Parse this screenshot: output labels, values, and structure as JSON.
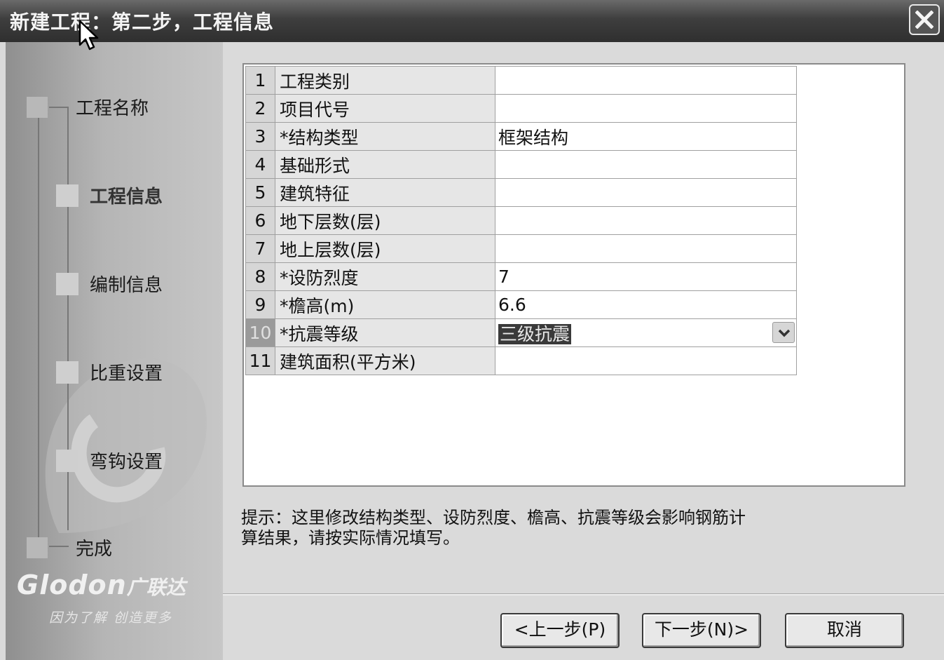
{
  "window": {
    "title": "新建工程：第二步，工程信息"
  },
  "sidebar": {
    "steps": [
      {
        "label": "工程名称"
      },
      {
        "label": "工程信息"
      },
      {
        "label": "编制信息"
      },
      {
        "label": "比重设置"
      },
      {
        "label": "弯钩设置"
      },
      {
        "label": "完成"
      }
    ],
    "current_step": "工程信息",
    "logo_text": "Glodon",
    "logo_cn": "广联达",
    "slogan": "因为了解 创造更多"
  },
  "grid": {
    "rows": [
      {
        "num": "1",
        "name": "工程类别",
        "value": ""
      },
      {
        "num": "2",
        "name": "项目代号",
        "value": ""
      },
      {
        "num": "3",
        "name": "*结构类型",
        "value": "框架结构"
      },
      {
        "num": "4",
        "name": "基础形式",
        "value": ""
      },
      {
        "num": "5",
        "name": "建筑特征",
        "value": ""
      },
      {
        "num": "6",
        "name": "地下层数(层)",
        "value": ""
      },
      {
        "num": "7",
        "name": "地上层数(层)",
        "value": ""
      },
      {
        "num": "8",
        "name": "*设防烈度",
        "value": "7"
      },
      {
        "num": "9",
        "name": "*檐高(m)",
        "value": "6.6"
      },
      {
        "num": "10",
        "name": "*抗震等级",
        "value": "三级抗震"
      },
      {
        "num": "11",
        "name": "建筑面积(平方米)",
        "value": ""
      }
    ]
  },
  "hint": {
    "line1": "提示：这里修改结构类型、设防烈度、檐高、抗震等级会影响钢筋计",
    "line2": "算结果，请按实际情况填写。"
  },
  "buttons": {
    "prev": "<上一步(P)",
    "next": "下一步(N)>",
    "cancel": "取消"
  }
}
